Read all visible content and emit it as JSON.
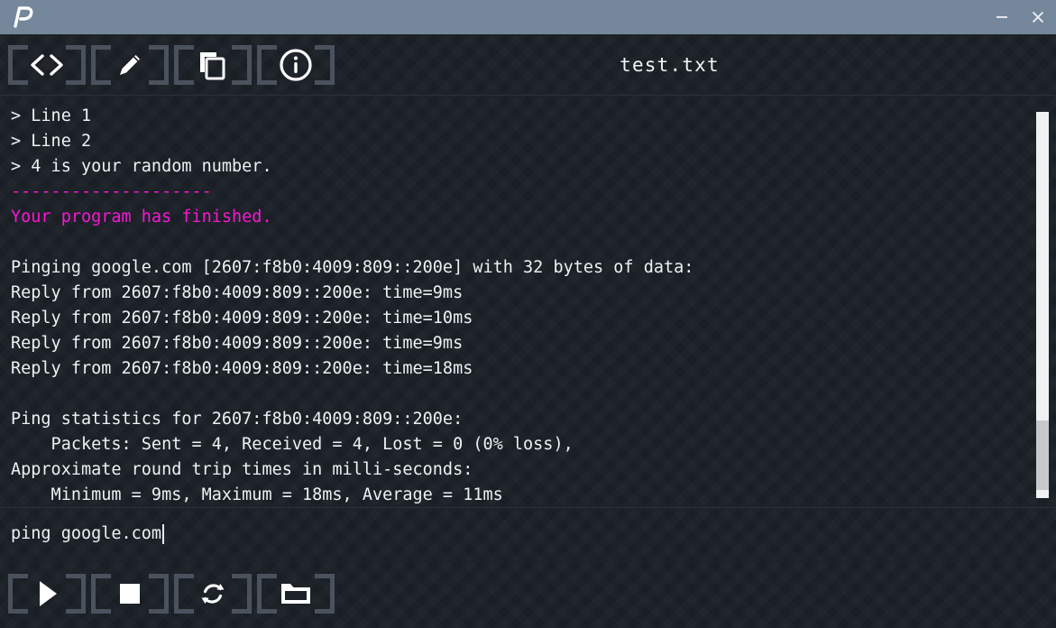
{
  "window": {
    "logo_label": "P",
    "minimize_label": "Minimize",
    "close_label": "Close",
    "titlebar_color": "#75879b"
  },
  "toolbar_top": {
    "file_title": "test.txt",
    "buttons": [
      {
        "name": "code-icon",
        "label": "Code view"
      },
      {
        "name": "pencil-icon",
        "label": "Edit"
      },
      {
        "name": "copy-icon",
        "label": "Copy"
      },
      {
        "name": "info-icon",
        "label": "Info"
      }
    ]
  },
  "console": {
    "accent_color": "#f916d4",
    "text_color": "#eef1f4",
    "lines": [
      {
        "text": "> Line 1",
        "color": "default"
      },
      {
        "text": "> Line 2",
        "color": "default"
      },
      {
        "text": "> 4 is your random number.",
        "color": "default"
      },
      {
        "text": "--------------------",
        "color": "magenta"
      },
      {
        "text": "Your program has finished.",
        "color": "magenta"
      },
      {
        "text": "",
        "color": "default"
      },
      {
        "text": "Pinging google.com [2607:f8b0:4009:809::200e] with 32 bytes of data:",
        "color": "default"
      },
      {
        "text": "Reply from 2607:f8b0:4009:809::200e: time=9ms",
        "color": "default"
      },
      {
        "text": "Reply from 2607:f8b0:4009:809::200e: time=10ms",
        "color": "default"
      },
      {
        "text": "Reply from 2607:f8b0:4009:809::200e: time=9ms",
        "color": "default"
      },
      {
        "text": "Reply from 2607:f8b0:4009:809::200e: time=18ms",
        "color": "default"
      },
      {
        "text": "",
        "color": "default"
      },
      {
        "text": "Ping statistics for 2607:f8b0:4009:809::200e:",
        "color": "default"
      },
      {
        "text": "    Packets: Sent = 4, Received = 4, Lost = 0 (0% loss),",
        "color": "default"
      },
      {
        "text": "Approximate round trip times in milli-seconds:",
        "color": "default"
      },
      {
        "text": "    Minimum = 9ms, Maximum = 18ms, Average = 11ms",
        "color": "default"
      }
    ],
    "scrollbar": {
      "thumb_top_pct": 80,
      "thumb_height_pct": 18
    }
  },
  "input": {
    "value": "ping google.com",
    "placeholder": ""
  },
  "toolbar_bottom": {
    "buttons": [
      {
        "name": "play-icon",
        "label": "Run"
      },
      {
        "name": "stop-icon",
        "label": "Stop"
      },
      {
        "name": "refresh-icon",
        "label": "Restart"
      },
      {
        "name": "folder-icon",
        "label": "Open folder"
      }
    ]
  }
}
